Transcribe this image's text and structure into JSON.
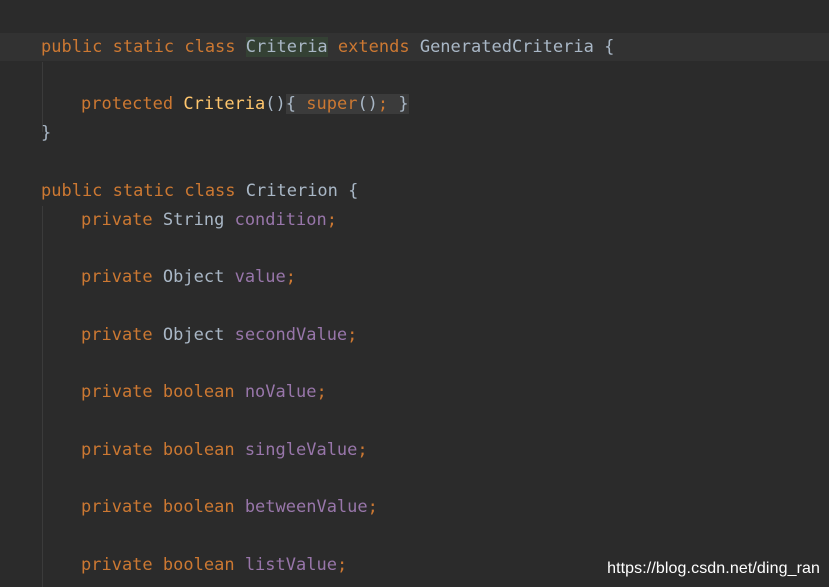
{
  "code": {
    "line1": {
      "kw_public": "public",
      "kw_static": "static",
      "kw_class": "class",
      "class_name": "Criteria",
      "kw_extends": "extends",
      "super_class": "GeneratedCriteria",
      "open_brace": "{"
    },
    "line2": {
      "kw_protected": "protected",
      "ctor_name": "Criteria",
      "parens": "()",
      "open_brace": "{",
      "kw_super": "super",
      "call_parens": "()",
      "semicolon": ";",
      "close_brace": "}"
    },
    "line3": {
      "close_brace": "}"
    },
    "line4": {
      "kw_public": "public",
      "kw_static": "static",
      "kw_class": "class",
      "class_name": "Criterion",
      "open_brace": "{"
    },
    "fields": [
      {
        "modifier": "private",
        "type": "String",
        "name": "condition",
        "semicolon": ";"
      },
      {
        "modifier": "private",
        "type": "Object",
        "name": "value",
        "semicolon": ";"
      },
      {
        "modifier": "private",
        "type": "Object",
        "name": "secondValue",
        "semicolon": ";"
      },
      {
        "modifier": "private",
        "type": "boolean",
        "name": "noValue",
        "semicolon": ";"
      },
      {
        "modifier": "private",
        "type": "boolean",
        "name": "singleValue",
        "semicolon": ";"
      },
      {
        "modifier": "private",
        "type": "boolean",
        "name": "betweenValue",
        "semicolon": ";"
      },
      {
        "modifier": "private",
        "type": "boolean",
        "name": "listValue",
        "semicolon": ";"
      }
    ]
  },
  "watermark": "https://blog.csdn.net/ding_ran",
  "colors": {
    "background": "#2b2b2b",
    "keyword": "#cc7832",
    "field": "#9876aa",
    "identifier": "#a9b7c6",
    "method": "#ffc66d"
  }
}
